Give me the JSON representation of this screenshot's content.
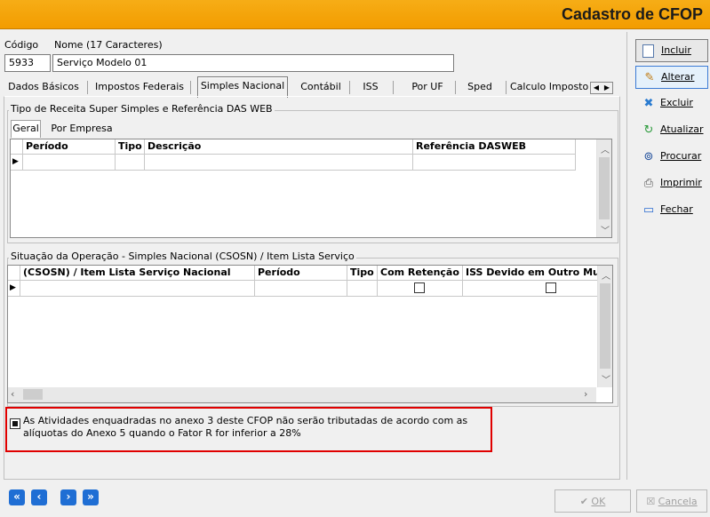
{
  "window": {
    "title": "Cadastro de CFOP"
  },
  "form": {
    "codigo_label": "Código",
    "nome_label": "Nome (17 Caracteres)",
    "codigo_value": "5933",
    "nome_value": "Serviço Modelo 01"
  },
  "tabs": [
    {
      "label": "Dados Básicos"
    },
    {
      "label": "Impostos Federais"
    },
    {
      "label": "Simples Nacional",
      "active": true
    },
    {
      "label": "Contábil"
    },
    {
      "label": "ISS"
    },
    {
      "label": "Por UF"
    },
    {
      "label": "Sped"
    },
    {
      "label": "Calculo Imposto"
    }
  ],
  "group1": {
    "title": "Tipo de Receita Super Simples e Referência DAS WEB",
    "subtabs": [
      "Geral",
      "Por Empresa"
    ],
    "columns": [
      "Período",
      "Tipo",
      "Descrição",
      "Referência DASWEB"
    ]
  },
  "group2": {
    "title": "Situação da Operação - Simples Nacional (CSOSN) / Item Lista Serviço",
    "columns": [
      "(CSOSN)  / Item  Lista Serviço  Nacional",
      "Período",
      "Tipo",
      "Com Retenção",
      "ISS Devido em Outro Mu"
    ]
  },
  "notice": {
    "text_line1": "As Atividades enquadradas no anexo 3 deste CFOP não serão tributadas de acordo com as",
    "text_line2": "alíquotas do Anexo 5 quando o Fator R for inferior a 28%",
    "checked": true
  },
  "sidebar": {
    "incluir": "Incluir",
    "alterar": "Alterar",
    "excluir": "Excluir",
    "atualizar": "Atualizar",
    "procurar": "Procurar",
    "imprimir": "Imprimir",
    "fechar": "Fechar"
  },
  "footer": {
    "ok": "OK",
    "cancela": "Cancela"
  },
  "colors": {
    "titlebar": "#f39c00",
    "highlight": "#e00000",
    "nav": "#1f6ed4"
  }
}
